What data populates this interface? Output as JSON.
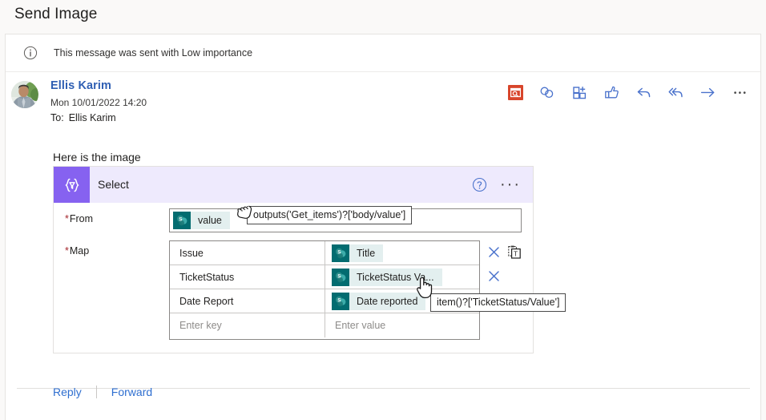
{
  "window": {
    "title": "Send Image"
  },
  "importance": {
    "icon": "info-circle-icon",
    "text": "This message was sent with Low importance"
  },
  "message_header": {
    "sender_name": "Ellis Karim",
    "sent_date": "Mon 10/01/2022 14:20",
    "to_label": "To:",
    "to_value": "Ellis Karim",
    "avatar_name": "avatar"
  },
  "toolbar": {
    "items": [
      {
        "name": "flag-red-icon",
        "label": "Follow up"
      },
      {
        "name": "tag-icon",
        "label": "Categorize"
      },
      {
        "name": "add-to-board-icon",
        "label": "Add to board"
      },
      {
        "name": "thumbs-up-icon",
        "label": "Like"
      },
      {
        "name": "reply-icon",
        "label": "Reply"
      },
      {
        "name": "reply-all-icon",
        "label": "Reply all"
      },
      {
        "name": "forward-arrow-icon",
        "label": "Forward"
      },
      {
        "name": "more-actions-icon",
        "label": "•••"
      }
    ]
  },
  "body": {
    "intro_text": "Here is the image"
  },
  "flow_card": {
    "icon": "select-braces-icon",
    "icon_glyph": "{▽}",
    "title": "Select",
    "help_icon": "help-circle-icon",
    "more_icon": "ellipsis-icon",
    "more_glyph": "···",
    "from": {
      "label": "From",
      "required_mark": "*",
      "token": {
        "icon": "sharepoint-icon",
        "label": "value"
      }
    },
    "map": {
      "label": "Map",
      "required_mark": "*",
      "rows": [
        {
          "key": "Issue",
          "value": "Title",
          "value_icon": "sharepoint-icon",
          "has_remove": true,
          "has_paste": true
        },
        {
          "key": "TicketStatus",
          "value": "TicketStatus Va...",
          "value_icon": "sharepoint-icon",
          "has_remove": true,
          "has_paste": false
        },
        {
          "key": "Date Report",
          "value": "Date reported",
          "value_icon": "sharepoint-icon",
          "has_remove": false,
          "has_paste": false
        }
      ],
      "new_row": {
        "key_placeholder": "Enter key",
        "value_placeholder": "Enter value"
      }
    }
  },
  "tooltips": {
    "from_expression": "outputs('Get_items')?['body/value']",
    "map_expression": "item()?['TicketStatus/Value']"
  },
  "footer": {
    "reply": "Reply",
    "forward": "Forward"
  },
  "colors": {
    "flow_accent": "#8662f0",
    "flow_header_bg": "#eeeafd",
    "sharepoint_teal": "#036c70",
    "link_blue": "#2f6fd0",
    "required_red": "#a4262c",
    "flag_red": "#d8452b",
    "token_bg": "#e3efef"
  }
}
